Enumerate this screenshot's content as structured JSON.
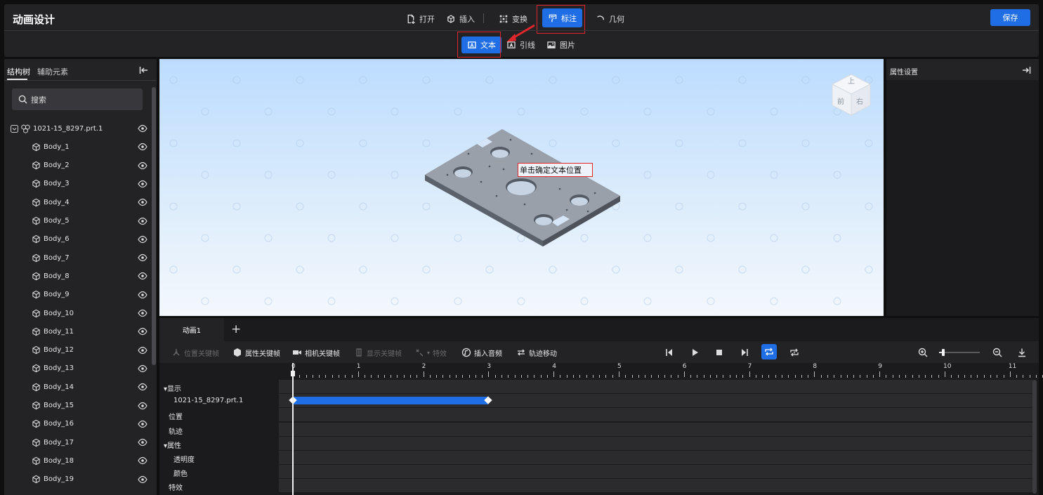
{
  "header": {
    "title": "动画设计",
    "menu": [
      {
        "label": "打开",
        "icon": "file-add-icon"
      },
      {
        "label": "插入",
        "icon": "cube-icon"
      },
      {
        "label": "变换",
        "icon": "transform-icon"
      },
      {
        "label": "标注",
        "icon": "annotation-icon"
      },
      {
        "label": "几何",
        "icon": "arc-icon"
      }
    ],
    "save_label": "保存"
  },
  "subtoolbar": [
    {
      "label": "文本",
      "icon": "text-box-icon"
    },
    {
      "label": "引线",
      "icon": "leader-icon"
    },
    {
      "label": "图片",
      "icon": "image-icon"
    }
  ],
  "left_panel": {
    "tabs": [
      "结构树",
      "辅助元素"
    ],
    "search_placeholder": "搜索",
    "root": "1021-15_8297.prt.1",
    "bodies": [
      "Body_1",
      "Body_2",
      "Body_3",
      "Body_4",
      "Body_5",
      "Body_6",
      "Body_7",
      "Body_8",
      "Body_9",
      "Body_10",
      "Body_11",
      "Body_12",
      "Body_13",
      "Body_14",
      "Body_15",
      "Body_16",
      "Body_17",
      "Body_18",
      "Body_19"
    ]
  },
  "viewport": {
    "hint": "单击确定文本位置",
    "viewcube": {
      "top": "上",
      "front": "前",
      "right": "右"
    }
  },
  "right_panel": {
    "title": "属性设置"
  },
  "timeline": {
    "tab": "动画1",
    "add_tab": "+",
    "tools": [
      {
        "label": "位置关键帧",
        "enabled": false
      },
      {
        "label": "属性关键帧",
        "enabled": true
      },
      {
        "label": "相机关键帧",
        "enabled": true
      },
      {
        "label": "显示关键帧",
        "enabled": false
      },
      {
        "label": "特效",
        "enabled": false
      },
      {
        "label": "插入音频",
        "enabled": true
      },
      {
        "label": "轨迹移动",
        "enabled": true
      }
    ],
    "tracks": [
      {
        "label": "▾显示",
        "indent": 0
      },
      {
        "label": "1021-15_8297.prt.1",
        "indent": 2
      },
      {
        "label": "位置",
        "indent": 1
      },
      {
        "label": "轨迹",
        "indent": 1
      },
      {
        "label": "▾属性",
        "indent": 0
      },
      {
        "label": "透明度",
        "indent": 2
      },
      {
        "label": "颜色",
        "indent": 2
      },
      {
        "label": "特效",
        "indent": 1
      }
    ],
    "ruler_ticks": [
      "0",
      "1",
      "2",
      "3",
      "4",
      "5",
      "6",
      "7",
      "8",
      "9",
      "10",
      "11"
    ],
    "clip": {
      "start": 0,
      "end": 3
    },
    "playhead": 0,
    "zoom_level": 0.1
  }
}
